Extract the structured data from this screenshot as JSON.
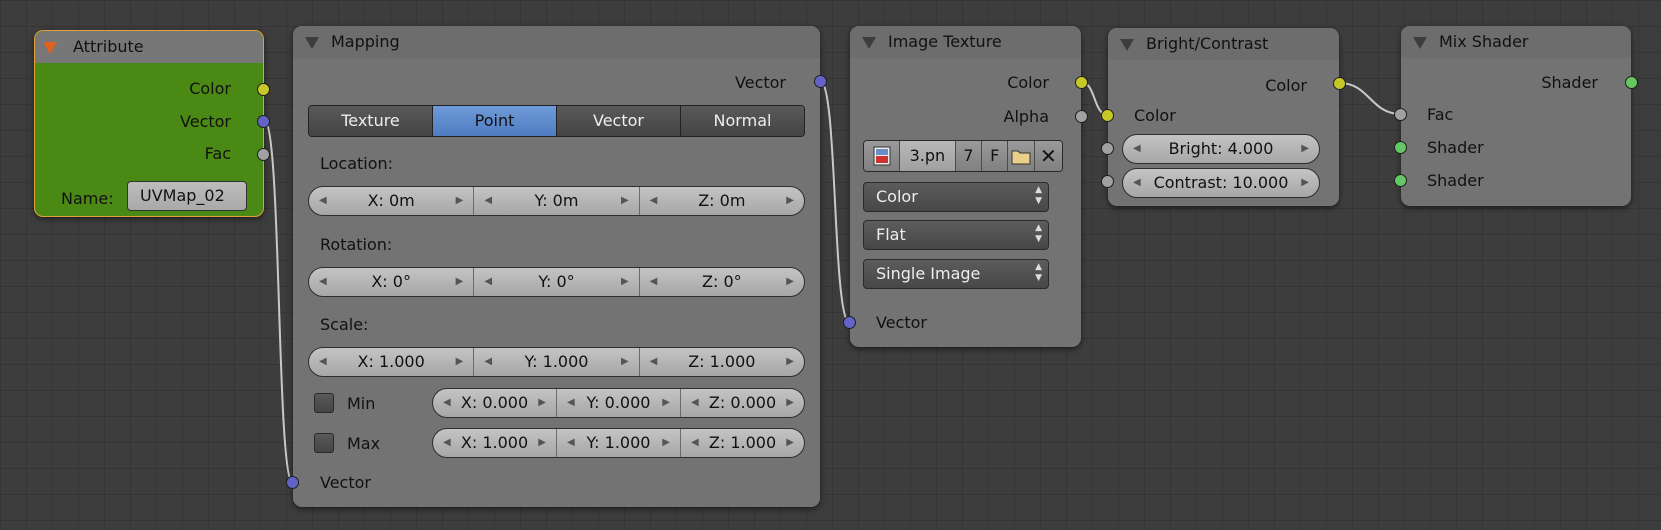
{
  "attribute_node": {
    "title": "Attribute",
    "outputs": [
      "Color",
      "Vector",
      "Fac"
    ],
    "name_label": "Name:",
    "name_value": "UVMap_02",
    "color": "#4a8a14"
  },
  "mapping_node": {
    "title": "Mapping",
    "output_vector": "Vector",
    "tabs": [
      "Texture",
      "Point",
      "Vector",
      "Normal"
    ],
    "active_tab": "Point",
    "location_label": "Location:",
    "location": [
      "X: 0m",
      "Y: 0m",
      "Z: 0m"
    ],
    "rotation_label": "Rotation:",
    "rotation": [
      "X: 0°",
      "Y: 0°",
      "Z: 0°"
    ],
    "scale_label": "Scale:",
    "scale": [
      "X: 1.000",
      "Y: 1.000",
      "Z: 1.000"
    ],
    "min_label": "Min",
    "min": [
      "X: 0.000",
      "Y: 0.000",
      "Z: 0.000"
    ],
    "max_label": "Max",
    "max": [
      "X: 1.000",
      "Y: 1.000",
      "Z: 1.000"
    ],
    "input_vector": "Vector"
  },
  "image_texture_node": {
    "title": "Image Texture",
    "outputs": [
      "Color",
      "Alpha"
    ],
    "image_name": "3.pn",
    "users": "7",
    "fake": "F",
    "color_space": "Color",
    "projection": "Flat",
    "source": "Single Image",
    "input_vector": "Vector"
  },
  "bright_contrast_node": {
    "title": "Bright/Contrast",
    "output_color": "Color",
    "input_color": "Color",
    "bright": "Bright: 4.000",
    "contrast": "Contrast: 10.000"
  },
  "mix_shader_node": {
    "title": "Mix Shader",
    "output_shader": "Shader",
    "inputs": [
      "Fac",
      "Shader",
      "Shader"
    ]
  },
  "colors": {
    "socket_color": "#c7c729",
    "socket_vector": "#6363c7",
    "socket_float": "#a1a1a1",
    "socket_shader": "#63c763",
    "active_tab": "#5b8bd3"
  }
}
